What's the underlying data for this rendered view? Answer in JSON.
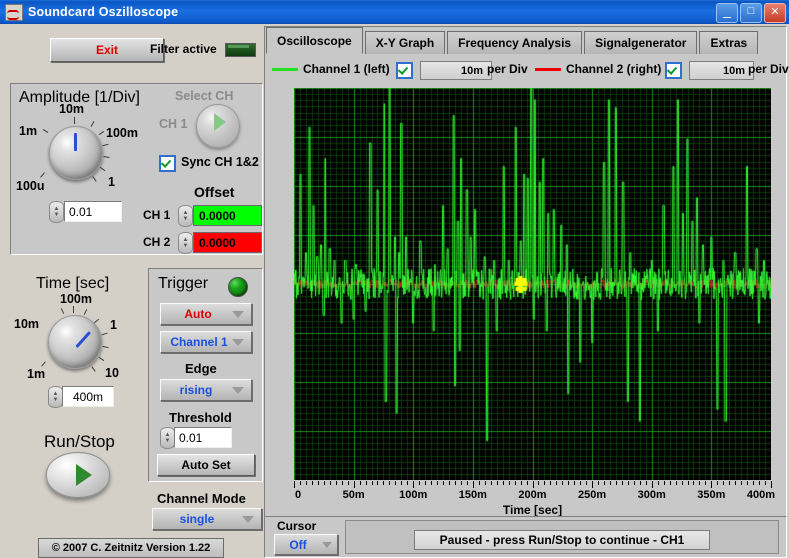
{
  "window": {
    "title": "Soundcard Oszilloscope",
    "icon": "waveform-icon",
    "buttons": {
      "minimize": "_",
      "maximize": "□",
      "close": "✕"
    }
  },
  "toolbar": {
    "exit_label": "Exit",
    "filter_label": "Filter active",
    "filter_state": "on"
  },
  "amplitude": {
    "title": "Amplitude [1/Div]",
    "knob_labels": [
      "100u",
      "1m",
      "10m",
      "100m",
      "1"
    ],
    "value": "0.01",
    "select_ch_title": "Select CH",
    "select_ch_value": "CH 1",
    "sync_label": "Sync CH 1&2",
    "sync_checked": true,
    "offset_title": "Offset",
    "offsets": [
      {
        "label": "CH 1",
        "value": "0.0000",
        "color": "#00ff00"
      },
      {
        "label": "CH 2",
        "value": "0.0000",
        "color": "#ff0000"
      }
    ]
  },
  "time": {
    "title": "Time [sec]",
    "knob_labels": [
      "1m",
      "10m",
      "100m",
      "1",
      "10"
    ],
    "value": "400m"
  },
  "trigger": {
    "title": "Trigger",
    "led": "on",
    "mode": "Auto",
    "channel": "Channel 1",
    "edge_label": "Edge",
    "edge": "rising",
    "threshold_label": "Threshold",
    "threshold": "0.01",
    "autoset_label": "Auto Set"
  },
  "runstop": {
    "label": "Run/Stop"
  },
  "channel_mode": {
    "label": "Channel Mode",
    "value": "single"
  },
  "copyright": "© 2007   C. Zeitnitz Version 1.22",
  "tabs": [
    {
      "label": "Oscilloscope",
      "active": true
    },
    {
      "label": "X-Y Graph",
      "active": false
    },
    {
      "label": "Frequency Analysis",
      "active": false
    },
    {
      "label": "Signalgenerator",
      "active": false
    },
    {
      "label": "Extras",
      "active": false
    }
  ],
  "channels": [
    {
      "name": "Channel 1 (left)",
      "color": "#22e022",
      "enabled": true,
      "per_div": "10m",
      "per_div_unit": "per Div"
    },
    {
      "name": "Channel 2 (right)",
      "color": "#f00000",
      "enabled": true,
      "per_div": "10m",
      "per_div_unit": "per Div"
    }
  ],
  "cursor": {
    "label": "Cursor",
    "value": "Off"
  },
  "status": "Paused - press Run/Stop to continue - CH1",
  "chart_data": {
    "type": "line",
    "title": "",
    "xlabel": "Time [sec]",
    "ylabel": "",
    "xlim": [
      0,
      0.4
    ],
    "ylim": [
      -0.05,
      0.05
    ],
    "xticks": [
      0,
      0.05,
      0.1,
      0.15,
      0.2,
      0.25,
      0.3,
      0.35,
      0.4
    ],
    "xticklabels": [
      "0",
      "50m",
      "100m",
      "150m",
      "200m",
      "250m",
      "300m",
      "350m",
      "400m"
    ],
    "grid": true,
    "grid_major_color": "#1f8f1f",
    "grid_minor_color": "#0d3a0d",
    "background": "#000000",
    "baseline": 0,
    "cursor_marker": {
      "x": 0.19,
      "y": 0.0,
      "color": "#ffff00"
    },
    "series": [
      {
        "name": "Channel 1 (left)",
        "color": "#33ff33",
        "description": "Noisy audio waveform with sharp transient spikes",
        "spikes_up": [
          [
            0.0055,
            0.028
          ],
          [
            0.01,
            0.008
          ],
          [
            0.013,
            0.04
          ],
          [
            0.0165,
            0.02
          ],
          [
            0.0195,
            0.007
          ],
          [
            0.0225,
            0.01
          ],
          [
            0.026,
            0.032
          ],
          [
            0.03,
            0.009
          ],
          [
            0.034,
            0.006
          ],
          [
            0.043,
            0.006
          ],
          [
            0.052,
            0.005
          ],
          [
            0.06,
            0.009
          ],
          [
            0.064,
            0.036
          ],
          [
            0.07,
            0.024
          ],
          [
            0.076,
            0.046
          ],
          [
            0.08,
            0.05
          ],
          [
            0.085,
            0.012
          ],
          [
            0.088,
            0.008
          ],
          [
            0.09,
            0.041
          ],
          [
            0.094,
            0.012
          ],
          [
            0.1,
            0.006
          ],
          [
            0.106,
            0.011
          ],
          [
            0.118,
            0.005
          ],
          [
            0.125,
            0.02
          ],
          [
            0.129,
            0.009
          ],
          [
            0.134,
            0.043
          ],
          [
            0.1375,
            0.016
          ],
          [
            0.14,
            0.032
          ],
          [
            0.145,
            0.024
          ],
          [
            0.148,
            0.012
          ],
          [
            0.152,
            0.019
          ],
          [
            0.16,
            0.007
          ],
          [
            0.168,
            0.006
          ],
          [
            0.176,
            0.03
          ],
          [
            0.18,
            0.006
          ],
          [
            0.186,
            0.04
          ],
          [
            0.19,
            0.011
          ],
          [
            0.193,
            0.028
          ],
          [
            0.196,
            0.027
          ],
          [
            0.199,
            0.05
          ],
          [
            0.202,
            0.047
          ],
          [
            0.206,
            0.026
          ],
          [
            0.209,
            0.032
          ],
          [
            0.213,
            0.018
          ],
          [
            0.218,
            0.019
          ],
          [
            0.224,
            0.015
          ],
          [
            0.229,
            0.01
          ],
          [
            0.24,
            0.008
          ],
          [
            0.25,
            0.005
          ],
          [
            0.26,
            0.031
          ],
          [
            0.264,
            0.047
          ],
          [
            0.27,
            0.045
          ],
          [
            0.276,
            0.026
          ],
          [
            0.282,
            0.008
          ],
          [
            0.29,
            0.007
          ],
          [
            0.3,
            0.006
          ],
          [
            0.31,
            0.02
          ],
          [
            0.318,
            0.03
          ],
          [
            0.322,
            0.047
          ],
          [
            0.326,
            0.018
          ],
          [
            0.33,
            0.037
          ],
          [
            0.334,
            0.016
          ],
          [
            0.338,
            0.022
          ],
          [
            0.343,
            0.01
          ],
          [
            0.35,
            0.012
          ],
          [
            0.36,
            0.006
          ],
          [
            0.37,
            0.008
          ],
          [
            0.38,
            0.03
          ],
          [
            0.388,
            0.009
          ],
          [
            0.394,
            0.006
          ]
        ],
        "spikes_down": [
          [
            0.025,
            -0.008
          ],
          [
            0.04,
            -0.01
          ],
          [
            0.05,
            -0.009
          ],
          [
            0.06,
            -0.007
          ],
          [
            0.077,
            -0.03
          ],
          [
            0.086,
            -0.033
          ],
          [
            0.1,
            -0.01
          ],
          [
            0.117,
            -0.012
          ],
          [
            0.135,
            -0.026
          ],
          [
            0.139,
            -0.017
          ],
          [
            0.162,
            -0.04
          ],
          [
            0.17,
            -0.012
          ],
          [
            0.201,
            -0.009
          ],
          [
            0.212,
            -0.012
          ],
          [
            0.23,
            -0.028
          ],
          [
            0.24,
            -0.02
          ],
          [
            0.25,
            -0.015
          ],
          [
            0.28,
            -0.03
          ],
          [
            0.29,
            -0.035
          ],
          [
            0.305,
            -0.012
          ],
          [
            0.34,
            -0.01
          ],
          [
            0.355,
            -0.032
          ],
          [
            0.362,
            -0.035
          ],
          [
            0.39,
            -0.01
          ]
        ],
        "noise_amplitude": 0.004
      },
      {
        "name": "Channel 2 (right)",
        "color": "#cc2222",
        "description": "Near-flat baseline trace overlaid on channel 1",
        "spikes_up": [],
        "spikes_down": [],
        "noise_amplitude": 0.0012
      }
    ]
  }
}
